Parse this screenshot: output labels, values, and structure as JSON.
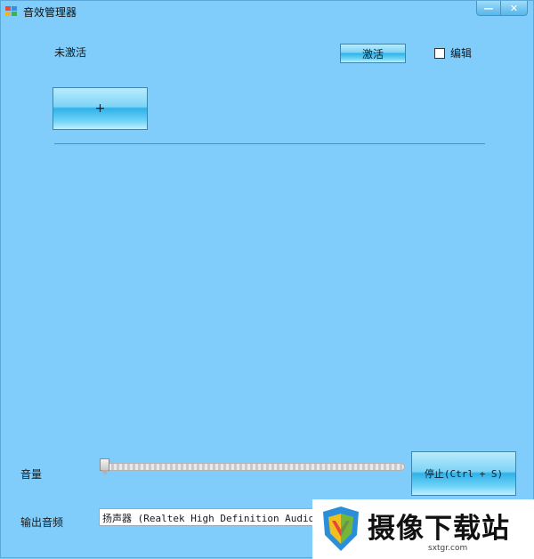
{
  "window": {
    "title": "音效管理器",
    "minimize_glyph": "—",
    "close_glyph": "✕"
  },
  "status": {
    "label": "未激活"
  },
  "activate_button": {
    "label": "激活"
  },
  "edit_checkbox": {
    "label": "编辑",
    "checked": false
  },
  "add_button": {
    "label": "+"
  },
  "volume": {
    "label": "音量",
    "value": 0
  },
  "stop_button": {
    "label": "停止(Ctrl + S)"
  },
  "output": {
    "label": "输出音频",
    "selected": "扬声器 (Realtek High Definition Audio)"
  },
  "watermark": {
    "title": "摄像下载站",
    "url": "sxtgr.com"
  },
  "colors": {
    "window_bg": "#80cdfb",
    "button_accent": "#2fb2e8",
    "divider": "#3f95c9"
  }
}
